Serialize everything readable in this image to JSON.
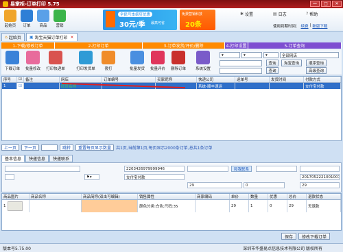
{
  "window": {
    "title": "易掌柜-订单打印 5.75",
    "min": "—",
    "max": "□",
    "close": "✕"
  },
  "toolbar": {
    "start": "起始页",
    "order": "订单",
    "product": "商品",
    "marketing": "营销"
  },
  "banners": {
    "b1_top": "全民亏本疯狂优惠",
    "b1_main": "30元/季",
    "b1_note": "最高可省",
    "b2_top": "免费营销科技",
    "b2_main": "20条",
    "b2_side": "选购"
  },
  "toplinks": {
    "settings": "设置",
    "log": "日志",
    "help": "帮助",
    "user_prefix": "使用到期时间：",
    "renew": "续费",
    "new_version": "新版下载"
  },
  "tabs": [
    "起始页",
    "淘宝天猫订单打印"
  ],
  "steps": [
    "1-下载/修改订单",
    "2-打印订单",
    "3-订单发货/评价/删除",
    "4-打印设置",
    "5-订单查询"
  ],
  "buttons": {
    "download": "下载订单",
    "batch_edit": "批量修改",
    "print_express": "打印快递单",
    "print_delivery": "打印发货单",
    "set_print": "套打",
    "batch_ship": "批量发货",
    "batch_rate": "批量评价",
    "delete_order": "删除订单",
    "system_settings": "系统设置"
  },
  "filters": {
    "store": "全部网店",
    "query": "查询",
    "query_tb": "淘宝查询",
    "bulk_query": "顺序查询",
    "advanced": "高级查询"
  },
  "grid": {
    "headers": [
      "序号",
      "",
      "备注",
      "网店",
      "订单编号",
      "买家昵称",
      "快递公司",
      "运单号",
      "发货时间",
      "付款方式"
    ],
    "row": {
      "num": "1",
      "remark": "",
      "store": "旺旺名称",
      "order_id": "",
      "buyer": "",
      "express": "系统-顺丰速运",
      "waybill": "",
      "ship_time": "",
      "payment": "支付宝付款"
    }
  },
  "pager": {
    "prev": "上一页",
    "next": "下一页",
    "jump": "跳转",
    "reset": "重置每页显示数量",
    "info": "共1页,当前第1页,每页显示2000条订单,总共1条订单"
  },
  "detail_tabs": [
    "基本信息",
    "快递信息",
    "快递联系"
  ],
  "detail": {
    "order_no": "2203426979999946",
    "contact": "和我联系",
    "pay_label": "支付宝付款",
    "date_code": "2017052221001001",
    "qty": "29",
    "zero": "0",
    "amount": "29"
  },
  "items": {
    "headers": [
      "商品图片",
      "商品名称",
      "商品简称(双击可编辑)",
      "销售属性",
      "商家编码",
      "单价",
      "数量",
      "优惠",
      "总价",
      "退款状态"
    ],
    "row": {
      "num": "1",
      "name": "",
      "short": "",
      "attr": "颜色分类:白色;尺码:35",
      "code": "",
      "price": "29",
      "qty": "1",
      "discount": "0",
      "total": "29",
      "refund": "无退款"
    }
  },
  "bottom": {
    "save": "保存",
    "sync": "修改下载订单"
  },
  "status": {
    "version": "版本号5.75.00",
    "company": "深圳市华盛易点信息技术有限公司 版权所有"
  }
}
